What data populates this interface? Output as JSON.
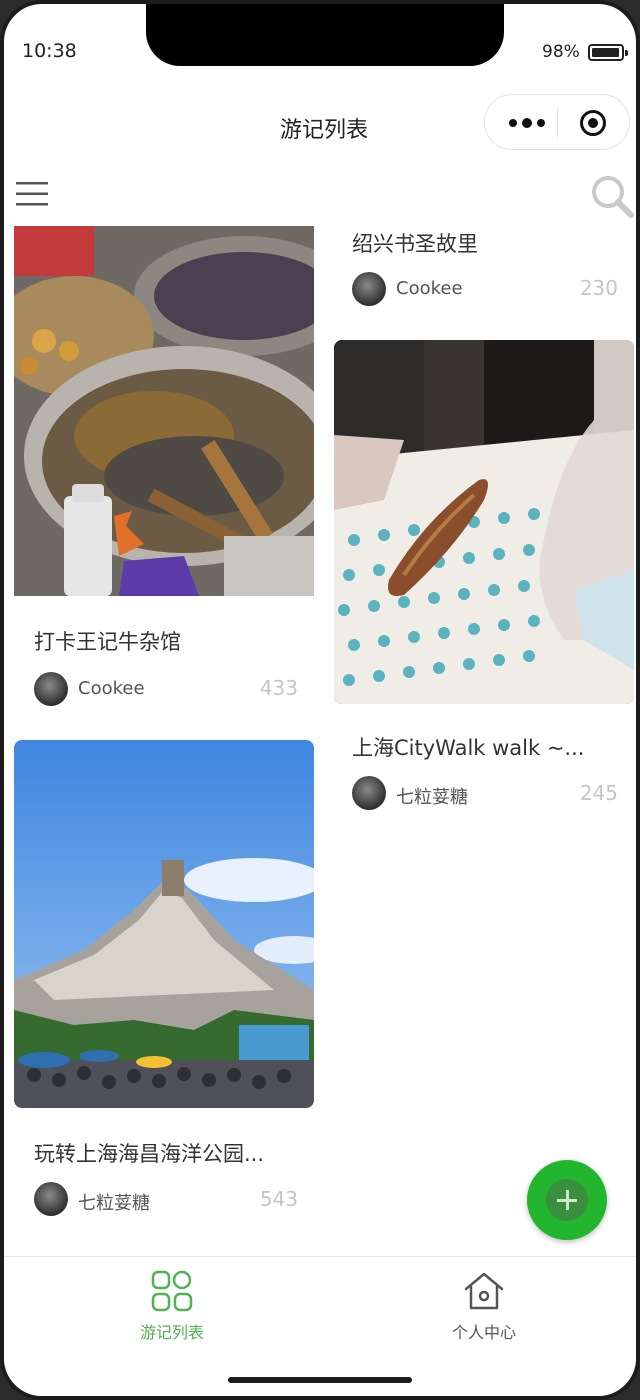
{
  "status_bar": {
    "time": "10:38",
    "battery": "98%"
  },
  "nav": {
    "title": "游记列表"
  },
  "cards": [
    {
      "title": "打卡王记牛杂馆",
      "author": "Cookee",
      "count": "433"
    },
    {
      "title": "绍兴书圣故里",
      "author": "Cookee",
      "count": "230"
    },
    {
      "title": "上海CityWalk walk ~...",
      "author": "七粒荽糖",
      "count": "245"
    },
    {
      "title": "玩转上海海昌海洋公园...",
      "author": "七粒荽糖",
      "count": "543"
    }
  ],
  "tabbar": {
    "tabs": [
      {
        "label": "游记列表",
        "active": true
      },
      {
        "label": "个人中心",
        "active": false
      }
    ]
  },
  "colors": {
    "accent": "#22b52e",
    "tab_active": "#4fb352",
    "count": "#c6c6c6"
  }
}
